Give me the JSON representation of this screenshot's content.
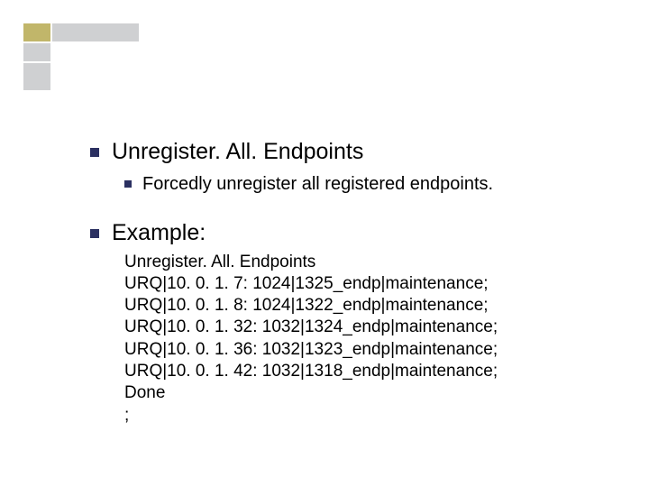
{
  "sections": {
    "unregister": {
      "title": "Unregister. All. Endpoints",
      "desc": "Forcedly unregister all registered endpoints."
    },
    "example": {
      "title": "Example:",
      "lines": [
        "Unregister. All. Endpoints",
        "URQ|10. 0. 1. 7: 1024|1325_endp|maintenance;",
        "URQ|10. 0. 1. 8: 1024|1322_endp|maintenance;",
        "URQ|10. 0. 1. 32: 1032|1324_endp|maintenance;",
        "URQ|10. 0. 1. 36: 1032|1323_endp|maintenance;",
        "URQ|10. 0. 1. 42: 1032|1318_endp|maintenance;",
        "Done",
        ";"
      ]
    }
  },
  "decor": {
    "corner_accent": "#c1b66a",
    "corner_gray": "#cfd0d2"
  }
}
